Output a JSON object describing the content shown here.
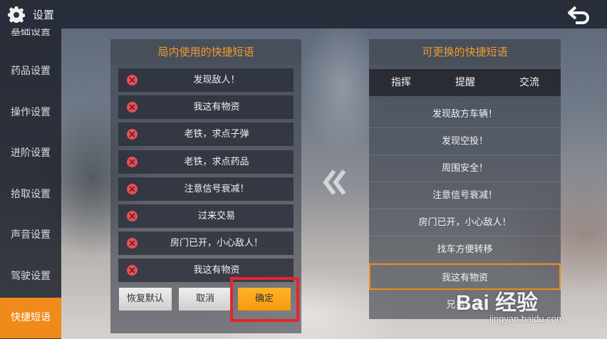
{
  "header": {
    "title": "设置"
  },
  "sidebar": {
    "items": [
      {
        "label": "基础设置"
      },
      {
        "label": "药品设置"
      },
      {
        "label": "操作设置"
      },
      {
        "label": "进阶设置"
      },
      {
        "label": "拾取设置"
      },
      {
        "label": "声音设置"
      },
      {
        "label": "驾驶设置"
      },
      {
        "label": "快捷短语"
      }
    ],
    "active": "快捷短语"
  },
  "left_panel": {
    "title": "局内使用的快捷短语",
    "phrases": [
      {
        "text": "发现敌人！"
      },
      {
        "text": "我这有物资"
      },
      {
        "text": "老铁，求点子弹"
      },
      {
        "text": "老铁，求点药品"
      },
      {
        "text": "注意信号衰减！"
      },
      {
        "text": "过来交易"
      },
      {
        "text": "房门已开，小心敌人！"
      },
      {
        "text": "我这有物资"
      }
    ],
    "buttons": {
      "reset": "恢复默认",
      "cancel": "取消",
      "confirm": "确定"
    }
  },
  "right_panel": {
    "title": "可更换的快捷短语",
    "tabs": [
      "指挥",
      "提醒",
      "交流"
    ],
    "phrases": [
      {
        "text": "发现敌方车辆！"
      },
      {
        "text": "发现空投！"
      },
      {
        "text": "周围安全！"
      },
      {
        "text": "注意信号衰减！"
      },
      {
        "text": "房门已开，小心敌人！"
      },
      {
        "text": "找车方便转移"
      },
      {
        "text": "我这有物资"
      },
      {
        "text": "兄弟，来"
      }
    ],
    "selected": "我这有物资"
  },
  "watermark": {
    "logo": "Bai 经验",
    "url": "jingyan.baidu.com"
  },
  "colors": {
    "accent": "#ef8a1b",
    "title": "#f29a2e",
    "highlight": "#e5252a",
    "delete": "#e4525a"
  },
  "icons": [
    "gear-icon",
    "back-arrow-icon",
    "delete-icon",
    "double-chevron-left-icon"
  ]
}
